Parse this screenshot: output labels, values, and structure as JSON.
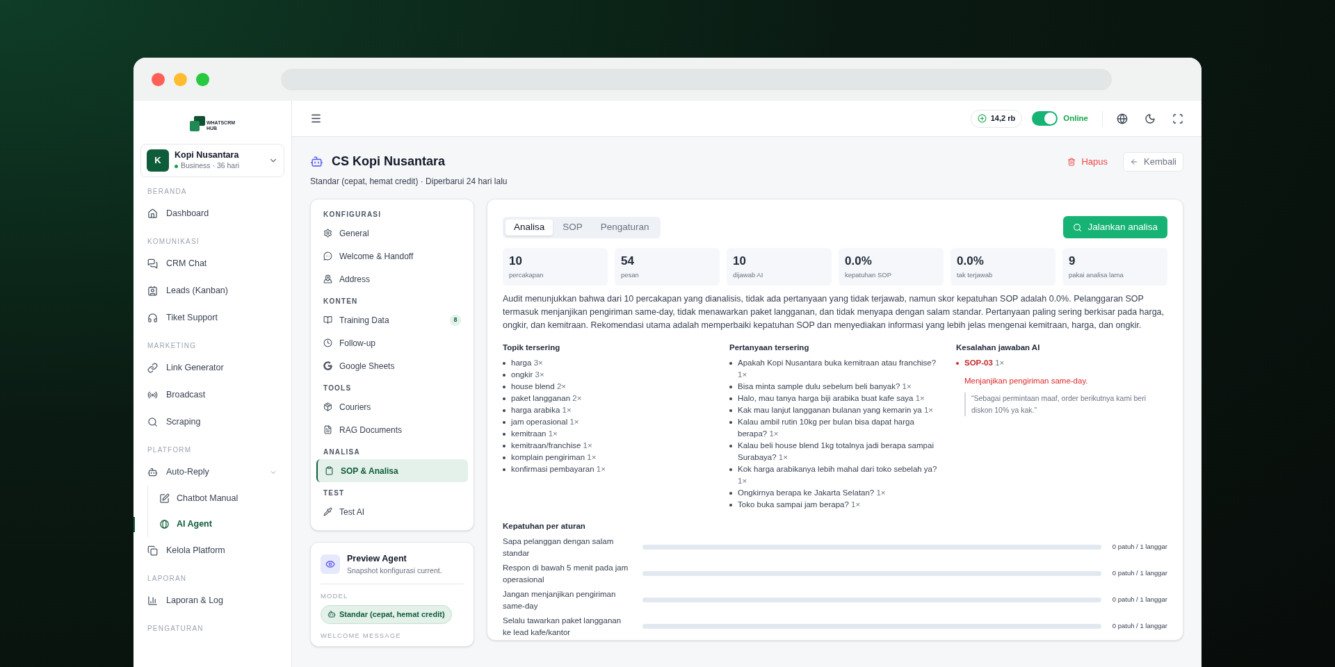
{
  "browser": {
    "dots": [
      {
        "color": "#ff5f57"
      },
      {
        "color": "#febc2e"
      },
      {
        "color": "#28c840"
      }
    ]
  },
  "sidebar": {
    "logo_lines": [
      "WHATSCRM",
      "HUB"
    ],
    "account": {
      "initial": "K",
      "name": "Kopi Nusantara",
      "plan": "Business · 36 hari"
    },
    "sections": [
      {
        "title": "BERANDA",
        "items": [
          {
            "label": "Dashboard",
            "selected": false
          }
        ]
      },
      {
        "title": "KOMUNIKASI",
        "items": [
          {
            "label": "CRM Chat",
            "selected": false
          },
          {
            "label": "Leads (Kanban)",
            "selected": false
          },
          {
            "label": "Tiket Support",
            "selected": false
          }
        ]
      },
      {
        "title": "MARKETING",
        "items": [
          {
            "label": "Link Generator",
            "selected": false
          },
          {
            "label": "Broadcast",
            "selected": false
          },
          {
            "label": "Scraping",
            "selected": false
          }
        ]
      },
      {
        "title": "PLATFORM",
        "items": [
          {
            "label": "Auto-Reply",
            "selected": false,
            "expanded": true,
            "children": [
              {
                "label": "Chatbot Manual",
                "selected": false
              },
              {
                "label": "AI Agent",
                "selected": true
              }
            ]
          },
          {
            "label": "Kelola Platform",
            "selected": false
          }
        ]
      },
      {
        "title": "LAPORAN",
        "items": [
          {
            "label": "Laporan & Log",
            "selected": false
          }
        ]
      },
      {
        "title": "PENGATURAN"
      }
    ]
  },
  "topbar": {
    "credits": "14,2 rb",
    "status": {
      "label": "Online",
      "on": true
    }
  },
  "header": {
    "title": "CS Kopi Nusantara",
    "subtitle": "Standar (cepat, hemat credit) · Diperbarui 24 hari lalu",
    "delete": "Hapus",
    "back": "Kembali"
  },
  "config_nav": [
    {
      "title": "KONFIGURASI",
      "items": [
        {
          "label": "General",
          "selected": false
        },
        {
          "label": "Welcome & Handoff",
          "selected": false
        },
        {
          "label": "Address",
          "selected": false
        }
      ]
    },
    {
      "title": "KONTEN",
      "items": [
        {
          "label": "Training Data",
          "badge": "8",
          "selected": false
        },
        {
          "label": "Follow-up",
          "selected": false
        },
        {
          "label": "Google Sheets",
          "selected": false
        }
      ]
    },
    {
      "title": "TOOLS",
      "items": [
        {
          "label": "Couriers",
          "selected": false
        },
        {
          "label": "RAG Documents",
          "selected": false
        }
      ]
    },
    {
      "title": "ANALISA",
      "items": [
        {
          "label": "SOP & Analisa",
          "selected": true
        }
      ]
    },
    {
      "title": "TEST",
      "items": [
        {
          "label": "Test AI",
          "selected": false
        }
      ]
    }
  ],
  "preview": {
    "title": "Preview Agent",
    "subtitle": "Snapshot konfigurasi current.",
    "model_label": "MODEL",
    "model": "Standar (cepat, hemat credit)",
    "welcome_label": "WELCOME MESSAGE"
  },
  "analysis": {
    "tabs": [
      {
        "label": "Analisa",
        "selected": true
      },
      {
        "label": "SOP",
        "selected": false
      },
      {
        "label": "Pengaturan",
        "selected": false
      }
    ],
    "run_button": "Jalankan analisa",
    "stats": [
      {
        "value": "10",
        "label": "percakapan"
      },
      {
        "value": "54",
        "label": "pesan"
      },
      {
        "value": "10",
        "label": "dijawab AI"
      },
      {
        "value": "0.0%",
        "label": "kepatuhan SOP"
      },
      {
        "value": "0.0%",
        "label": "tak terjawab"
      },
      {
        "value": "9",
        "label": "pakai analisa lama"
      }
    ],
    "summary": "Audit menunjukkan bahwa dari 10 percakapan yang dianalisis, tidak ada pertanyaan yang tidak terjawab, namun skor kepatuhan SOP adalah 0.0%. Pelanggaran SOP termasuk menjanjikan pengiriman same-day, tidak menawarkan paket langganan, dan tidak menyapa dengan salam standar. Pertanyaan paling sering berkisar pada harga, ongkir, dan kemitraan. Rekomendasi utama adalah memperbaiki kepatuhan SOP dan menyediakan informasi yang lebih jelas mengenai kemitraan, harga, dan ongkir.",
    "topics": {
      "title": "Topik tersering",
      "items": [
        {
          "text": "harga",
          "count": "3×"
        },
        {
          "text": "ongkir",
          "count": "3×"
        },
        {
          "text": "house blend",
          "count": "2×"
        },
        {
          "text": "paket langganan",
          "count": "2×"
        },
        {
          "text": "harga arabika",
          "count": "1×"
        },
        {
          "text": "jam operasional",
          "count": "1×"
        },
        {
          "text": "kemitraan",
          "count": "1×"
        },
        {
          "text": "kemitraan/franchise",
          "count": "1×"
        },
        {
          "text": "komplain pengiriman",
          "count": "1×"
        },
        {
          "text": "konfirmasi pembayaran",
          "count": "1×"
        }
      ]
    },
    "questions": {
      "title": "Pertanyaan tersering",
      "items": [
        {
          "text": "Apakah Kopi Nusantara buka kemitraan atau franchise?",
          "count": "1×"
        },
        {
          "text": "Bisa minta sample dulu sebelum beli banyak?",
          "count": "1×"
        },
        {
          "text": "Halo, mau tanya harga biji arabika buat kafe saya",
          "count": "1×"
        },
        {
          "text": "Kak mau lanjut langganan bulanan yang kemarin ya",
          "count": "1×"
        },
        {
          "text": "Kalau ambil rutin 10kg per bulan bisa dapat harga berapa?",
          "count": "1×"
        },
        {
          "text": "Kalau beli house blend 1kg totalnya jadi berapa sampai Surabaya?",
          "count": "1×"
        },
        {
          "text": "Kok harga arabikanya lebih mahal dari toko sebelah ya?",
          "count": "1×"
        },
        {
          "text": "Ongkirnya berapa ke Jakarta Selatan?",
          "count": "1×"
        },
        {
          "text": "Toko buka sampai jam berapa?",
          "count": "1×"
        }
      ]
    },
    "errors": {
      "title": "Kesalahan jawaban AI",
      "items": [
        {
          "code": "SOP-03",
          "count": "1×",
          "description": "Menjanjikan pengiriman same-day.",
          "quote": "“Sebagai permintaan maaf, order berikutnya kami beri diskon 10% ya kak.”"
        }
      ]
    },
    "compliance": {
      "title": "Kepatuhan per aturan",
      "rules": [
        {
          "text": "Sapa pelanggan dengan salam standar",
          "level": 0,
          "reading": "0 patuh / 1 langgar"
        },
        {
          "text": "Respon di bawah 5 menit pada jam operasional",
          "level": 0,
          "reading": "0 patuh / 1 langgar"
        },
        {
          "text": "Jangan menjanjikan pengiriman same-day",
          "level": 0,
          "reading": "0 patuh / 1 langgar"
        },
        {
          "text": "Selalu tawarkan paket langganan ke lead kafe/kantor",
          "level": 0,
          "reading": "0 patuh / 1 langgar"
        }
      ]
    }
  }
}
